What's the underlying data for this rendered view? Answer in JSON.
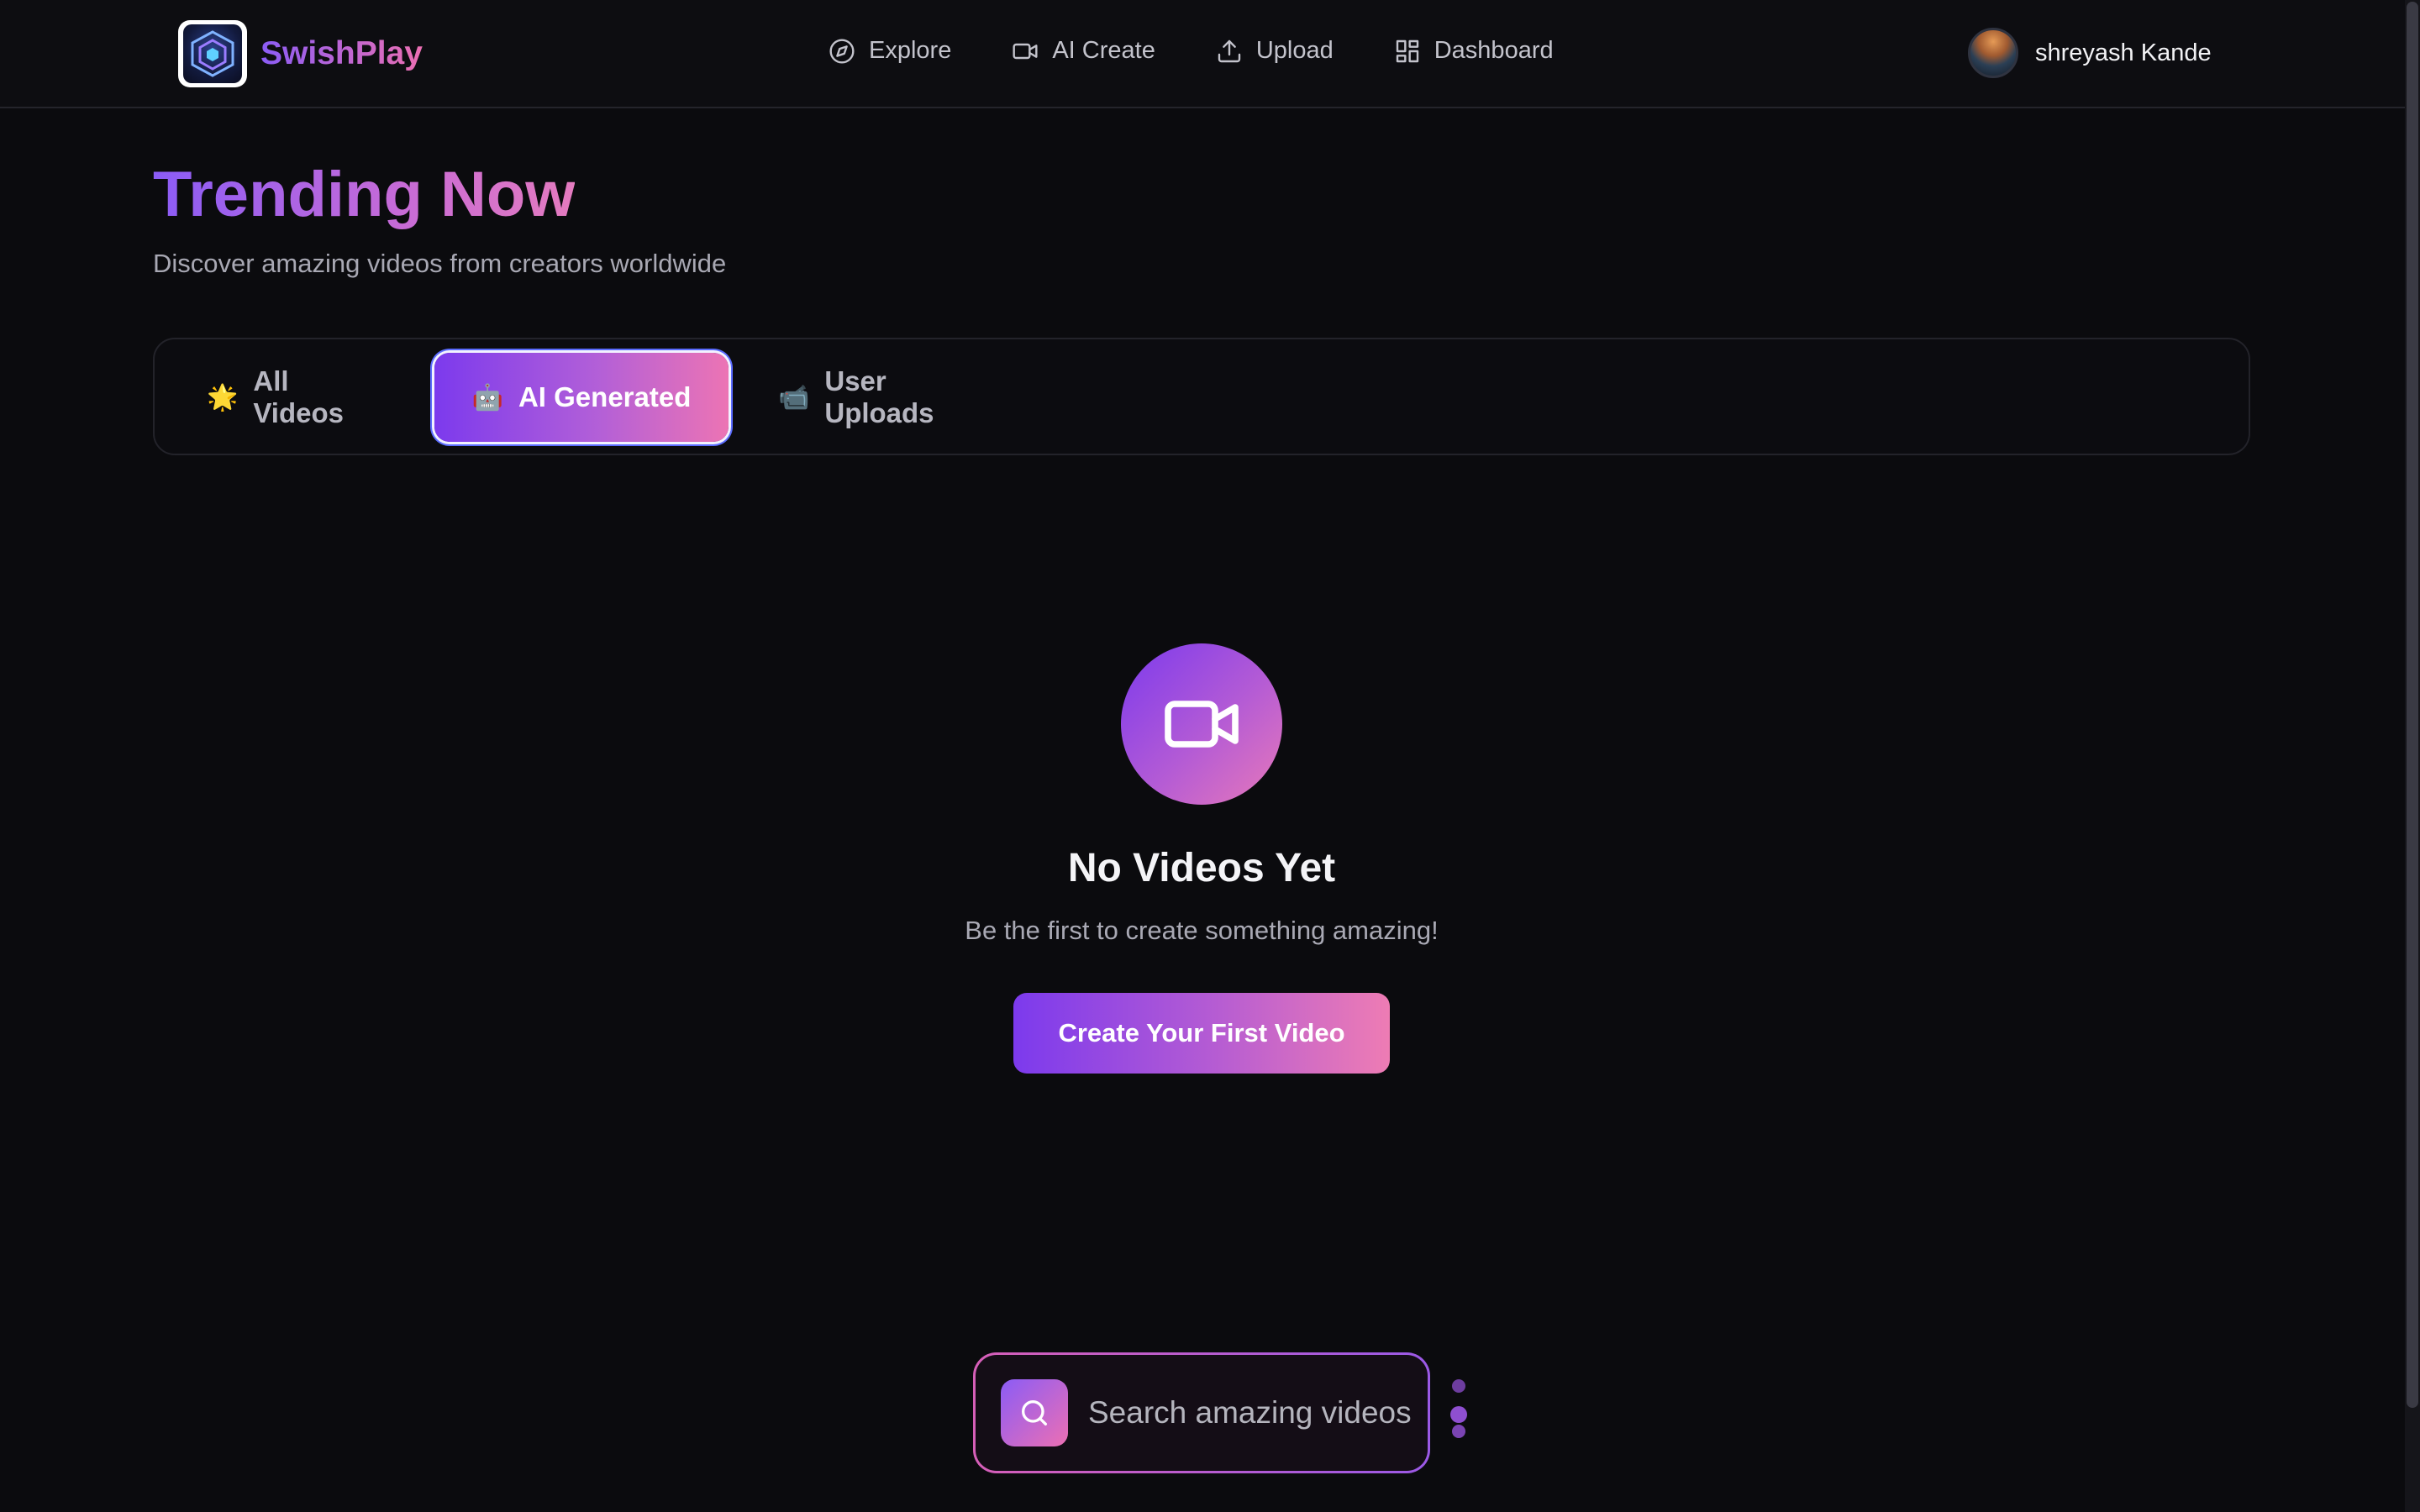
{
  "app": {
    "brand_name": "SwishPlay"
  },
  "nav": {
    "items": [
      {
        "label": "Explore",
        "icon": "compass-icon"
      },
      {
        "label": "AI Create",
        "icon": "video-camera-icon"
      },
      {
        "label": "Upload",
        "icon": "upload-icon"
      },
      {
        "label": "Dashboard",
        "icon": "dashboard-grid-icon"
      }
    ]
  },
  "user": {
    "name": "shreyash Kande"
  },
  "hero": {
    "title": "Trending Now",
    "subtitle": "Discover amazing videos from creators worldwide"
  },
  "tabs": [
    {
      "label": "All Videos",
      "emoji": "🌟",
      "active": false
    },
    {
      "label": "AI Generated",
      "emoji": "🤖",
      "active": true
    },
    {
      "label": "User Uploads",
      "emoji": "📹",
      "active": false
    }
  ],
  "empty_state": {
    "icon": "video-camera-icon",
    "title": "No Videos Yet",
    "subtitle": "Be the first to create something amazing!",
    "cta_label": "Create Your First Video"
  },
  "search": {
    "placeholder": "Search amazing videos",
    "value": ""
  },
  "colors": {
    "background": "#0b0b0e",
    "accent_purple": "#7c3aed",
    "accent_pink": "#ec74b4",
    "text_muted": "#a8a8b3"
  }
}
